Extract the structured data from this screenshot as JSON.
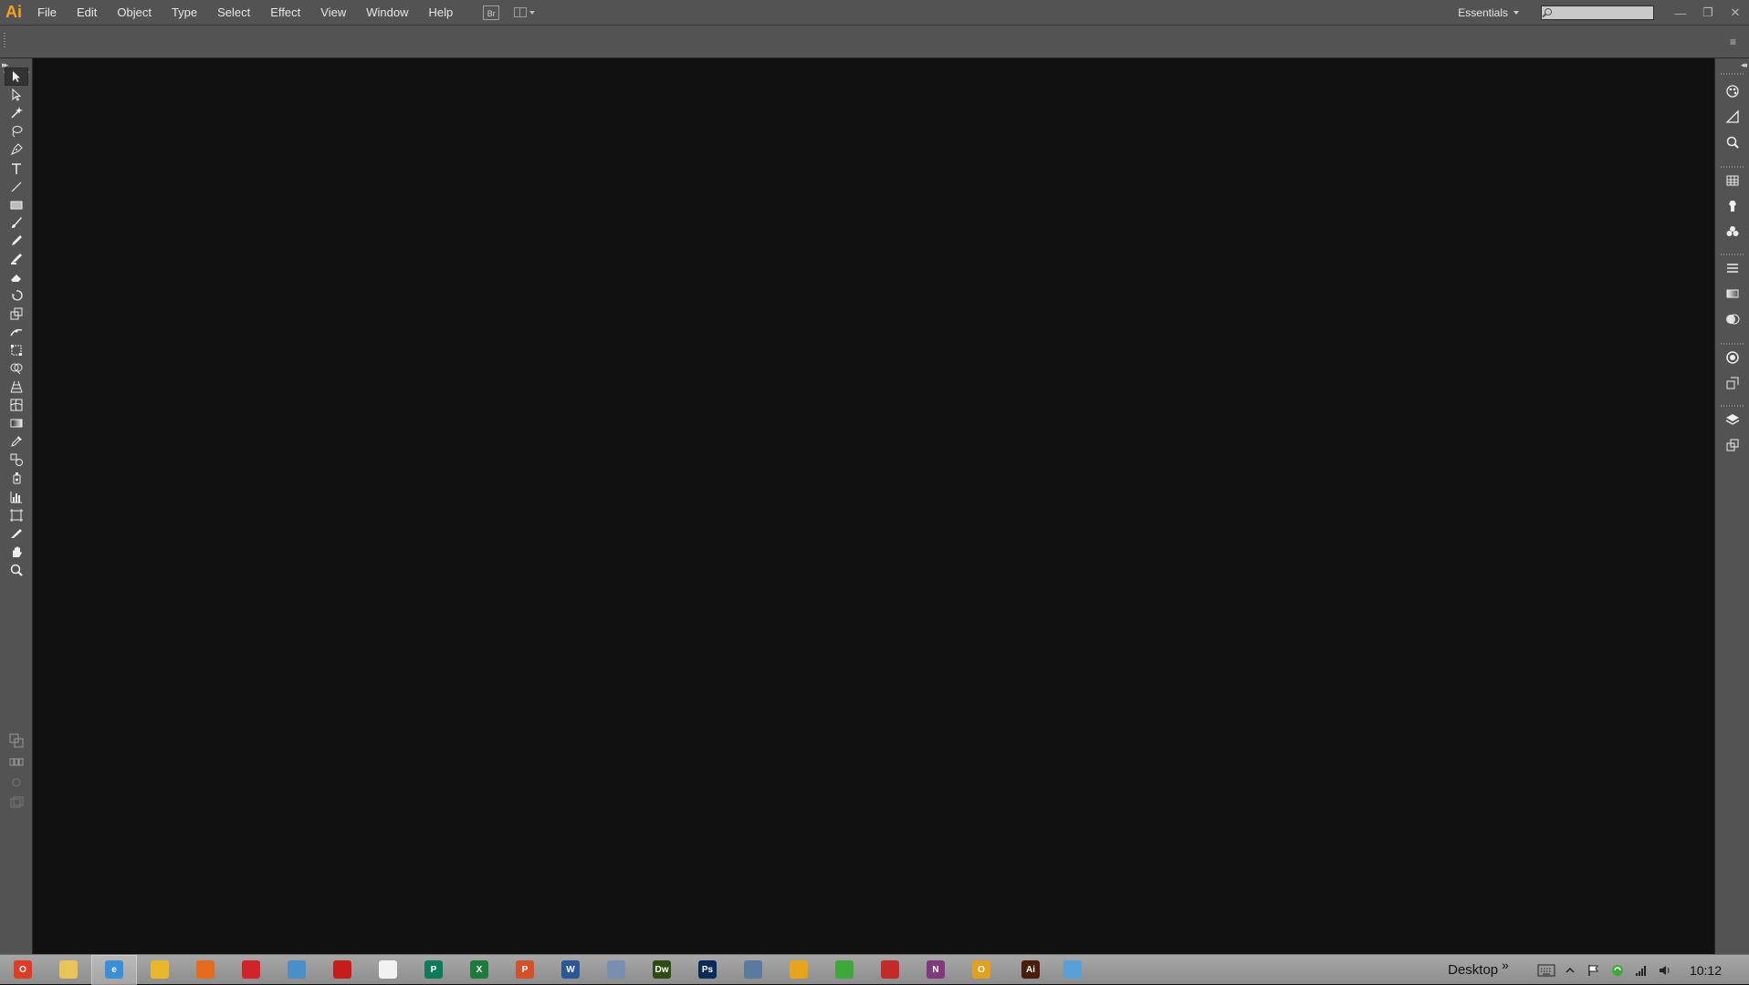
{
  "app": {
    "logo": "Ai"
  },
  "menu": [
    "File",
    "Edit",
    "Object",
    "Type",
    "Select",
    "Effect",
    "View",
    "Window",
    "Help"
  ],
  "bridge_button": "Br",
  "workspace": {
    "label": "Essentials"
  },
  "search": {
    "placeholder": "",
    "value": ""
  },
  "window_controls": {
    "minimize": "—",
    "restore": "❐",
    "close": "✕"
  },
  "tools": [
    {
      "name": "selection-tool-icon",
      "active": true
    },
    {
      "name": "direct-selection-tool-icon"
    },
    {
      "name": "magic-wand-tool-icon"
    },
    {
      "name": "lasso-tool-icon"
    },
    {
      "name": "pen-tool-icon"
    },
    {
      "name": "type-tool-icon"
    },
    {
      "name": "line-segment-tool-icon"
    },
    {
      "name": "rectangle-tool-icon"
    },
    {
      "name": "paintbrush-tool-icon"
    },
    {
      "name": "pencil-tool-icon"
    },
    {
      "name": "blob-brush-tool-icon"
    },
    {
      "name": "eraser-tool-icon"
    },
    {
      "name": "rotate-tool-icon"
    },
    {
      "name": "scale-tool-icon"
    },
    {
      "name": "width-tool-icon"
    },
    {
      "name": "free-transform-tool-icon"
    },
    {
      "name": "shape-builder-tool-icon"
    },
    {
      "name": "perspective-grid-tool-icon"
    },
    {
      "name": "mesh-tool-icon"
    },
    {
      "name": "gradient-tool-icon"
    },
    {
      "name": "eyedropper-tool-icon"
    },
    {
      "name": "blend-tool-icon"
    },
    {
      "name": "symbol-sprayer-tool-icon"
    },
    {
      "name": "column-graph-tool-icon"
    },
    {
      "name": "artboard-tool-icon"
    },
    {
      "name": "slice-tool-icon"
    },
    {
      "name": "hand-tool-icon"
    },
    {
      "name": "zoom-tool-icon"
    }
  ],
  "right_panel_icons": [
    "color-panel-icon",
    "color-guide-panel-icon",
    "css-properties-panel-icon",
    "swatches-panel-icon",
    "brushes-panel-icon",
    "symbols-panel-icon",
    "stroke-panel-icon",
    "gradient-panel-icon",
    "transparency-panel-icon",
    "appearance-panel-icon",
    "graphic-styles-panel-icon",
    "layers-panel-icon",
    "artboards-panel-icon"
  ],
  "taskbar": {
    "apps": [
      {
        "name": "office-app-icon",
        "color": "#e03b24",
        "glyph": "O"
      },
      {
        "name": "file-explorer-icon",
        "color": "#e8c45a",
        "glyph": ""
      },
      {
        "name": "internet-explorer-icon",
        "color": "#3a8fd8",
        "glyph": "e",
        "active": true
      },
      {
        "name": "chrome-icon",
        "color": "#e8b82a",
        "glyph": ""
      },
      {
        "name": "firefox-icon",
        "color": "#e66b1e",
        "glyph": ""
      },
      {
        "name": "creative-cloud-icon",
        "color": "#d2232a",
        "glyph": ""
      },
      {
        "name": "remote-desktop-icon",
        "color": "#4a90c8",
        "glyph": ""
      },
      {
        "name": "acrobat-icon",
        "color": "#c71c1c",
        "glyph": ""
      },
      {
        "name": "acrobat-reader-icon",
        "color": "#f2f2f2",
        "glyph": ""
      },
      {
        "name": "publisher-icon",
        "color": "#0e7a5c",
        "glyph": "P"
      },
      {
        "name": "excel-icon",
        "color": "#1e7a3a",
        "glyph": "X"
      },
      {
        "name": "powerpoint-icon",
        "color": "#d2502a",
        "glyph": "P"
      },
      {
        "name": "word-icon",
        "color": "#2b5797",
        "glyph": "W"
      },
      {
        "name": "infopath-icon",
        "color": "#7a8fb0",
        "glyph": ""
      },
      {
        "name": "dreamweaver-icon",
        "color": "#2d4b12",
        "glyph": "Dw"
      },
      {
        "name": "photoshop-icon",
        "color": "#0b2a5a",
        "glyph": "Ps"
      },
      {
        "name": "network-icon",
        "color": "#5a7aa0",
        "glyph": ""
      },
      {
        "name": "library-icon",
        "color": "#e6a41a",
        "glyph": ""
      },
      {
        "name": "evernote-icon",
        "color": "#3fa83a",
        "glyph": ""
      },
      {
        "name": "pdf-tool-icon",
        "color": "#c32a2a",
        "glyph": ""
      },
      {
        "name": "onenote-icon",
        "color": "#80397b",
        "glyph": "N"
      },
      {
        "name": "outlook-icon",
        "color": "#e0a020",
        "glyph": "O"
      },
      {
        "name": "illustrator-taskbar-icon",
        "color": "#4a1c0a",
        "glyph": "Ai"
      },
      {
        "name": "control-panel-icon",
        "color": "#5aa0d8",
        "glyph": ""
      }
    ],
    "desktop_label": "Desktop",
    "chevron": "»",
    "clock": "10:12"
  }
}
